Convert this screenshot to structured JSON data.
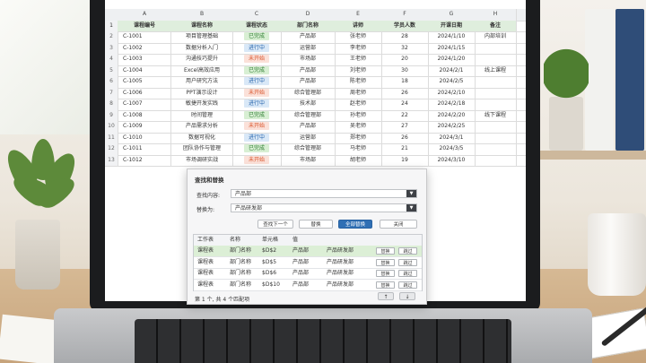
{
  "sheet": {
    "col_letters": [
      "A",
      "B",
      "C",
      "D",
      "E",
      "F",
      "G",
      "H"
    ],
    "headers": [
      "课程编号",
      "课程名称",
      "课程状态",
      "部门名称",
      "讲师",
      "学员人数",
      "开课日期",
      "备注"
    ],
    "rows": [
      {
        "n": "2",
        "id": "C-1001",
        "name": "项目管理基础",
        "status": "已完成",
        "dept": "产品部",
        "teacher": "张老师",
        "count": "28",
        "date": "2024/1/10",
        "note": "内部培训"
      },
      {
        "n": "3",
        "id": "C-1002",
        "name": "数据分析入门",
        "status": "进行中",
        "dept": "运营部",
        "teacher": "李老师",
        "count": "32",
        "date": "2024/1/15",
        "note": ""
      },
      {
        "n": "4",
        "id": "C-1003",
        "name": "沟通技巧提升",
        "status": "未开始",
        "dept": "市场部",
        "teacher": "王老师",
        "count": "20",
        "date": "2024/1/20",
        "note": ""
      },
      {
        "n": "5",
        "id": "C-1004",
        "name": "Excel高效应用",
        "status": "已完成",
        "dept": "产品部",
        "teacher": "刘老师",
        "count": "30",
        "date": "2024/2/1",
        "note": "线上课程"
      },
      {
        "n": "6",
        "id": "C-1005",
        "name": "用户研究方法",
        "status": "进行中",
        "dept": "产品部",
        "teacher": "陈老师",
        "count": "18",
        "date": "2024/2/5",
        "note": ""
      },
      {
        "n": "7",
        "id": "C-1006",
        "name": "PPT演示设计",
        "status": "未开始",
        "dept": "综合管理部",
        "teacher": "周老师",
        "count": "26",
        "date": "2024/2/10",
        "note": ""
      },
      {
        "n": "8",
        "id": "C-1007",
        "name": "敏捷开发实践",
        "status": "进行中",
        "dept": "技术部",
        "teacher": "赵老师",
        "count": "24",
        "date": "2024/2/18",
        "note": ""
      },
      {
        "n": "9",
        "id": "C-1008",
        "name": "时间管理",
        "status": "已完成",
        "dept": "综合管理部",
        "teacher": "孙老师",
        "count": "22",
        "date": "2024/2/20",
        "note": "线下课程"
      },
      {
        "n": "10",
        "id": "C-1009",
        "name": "产品需求分析",
        "status": "未开始",
        "dept": "产品部",
        "teacher": "吴老师",
        "count": "27",
        "date": "2024/2/25",
        "note": ""
      },
      {
        "n": "11",
        "id": "C-1010",
        "name": "数据可视化",
        "status": "进行中",
        "dept": "运营部",
        "teacher": "郑老师",
        "count": "26",
        "date": "2024/3/1",
        "note": ""
      },
      {
        "n": "12",
        "id": "C-1011",
        "name": "团队协作与管理",
        "status": "已完成",
        "dept": "综合管理部",
        "teacher": "马老师",
        "count": "21",
        "date": "2024/3/5",
        "note": ""
      },
      {
        "n": "13",
        "id": "C-1012",
        "name": "市场调研实战",
        "status": "未开始",
        "dept": "市场部",
        "teacher": "胡老师",
        "count": "19",
        "date": "2024/3/10",
        "note": ""
      }
    ]
  },
  "status_colors": {
    "已完成": {
      "bg": "#d8efd3",
      "fg": "#2e7d32"
    },
    "进行中": {
      "bg": "#d9e8f7",
      "fg": "#2b67ad"
    },
    "未开始": {
      "bg": "#fbe1d9",
      "fg": "#d9542b"
    }
  },
  "dialog": {
    "title": "查找和替换",
    "find_label": "查找内容:",
    "find_value": "产品部",
    "replace_label": "替换为:",
    "replace_value": "产品研发部",
    "buttons": {
      "find_next": "查找下一个",
      "replace": "替换",
      "replace_all": "全部替换",
      "close": "关闭"
    },
    "results_headers": [
      "工作表",
      "名称",
      "单元格",
      "值"
    ],
    "results": [
      {
        "sheet": "课程表",
        "name": "部门名称",
        "cell": "$D$2",
        "old": "产品部",
        "new": "产品研发部"
      },
      {
        "sheet": "课程表",
        "name": "部门名称",
        "cell": "$D$5",
        "old": "产品部",
        "new": "产品研发部"
      },
      {
        "sheet": "课程表",
        "name": "部门名称",
        "cell": "$D$6",
        "old": "产品部",
        "new": "产品研发部"
      },
      {
        "sheet": "课程表",
        "name": "部门名称",
        "cell": "$D$10",
        "old": "产品部",
        "new": "产品研发部"
      }
    ],
    "row_replace": "替换",
    "row_skip": "跳过",
    "footer": "第 1 个, 共 4 个匹配项",
    "up": "↑",
    "down": "↓",
    "combo_arrow": "▼"
  },
  "colors": {
    "accent": "#2f6fb4",
    "header_green": "#dfeedd",
    "selected_row": "#dcefd6"
  }
}
